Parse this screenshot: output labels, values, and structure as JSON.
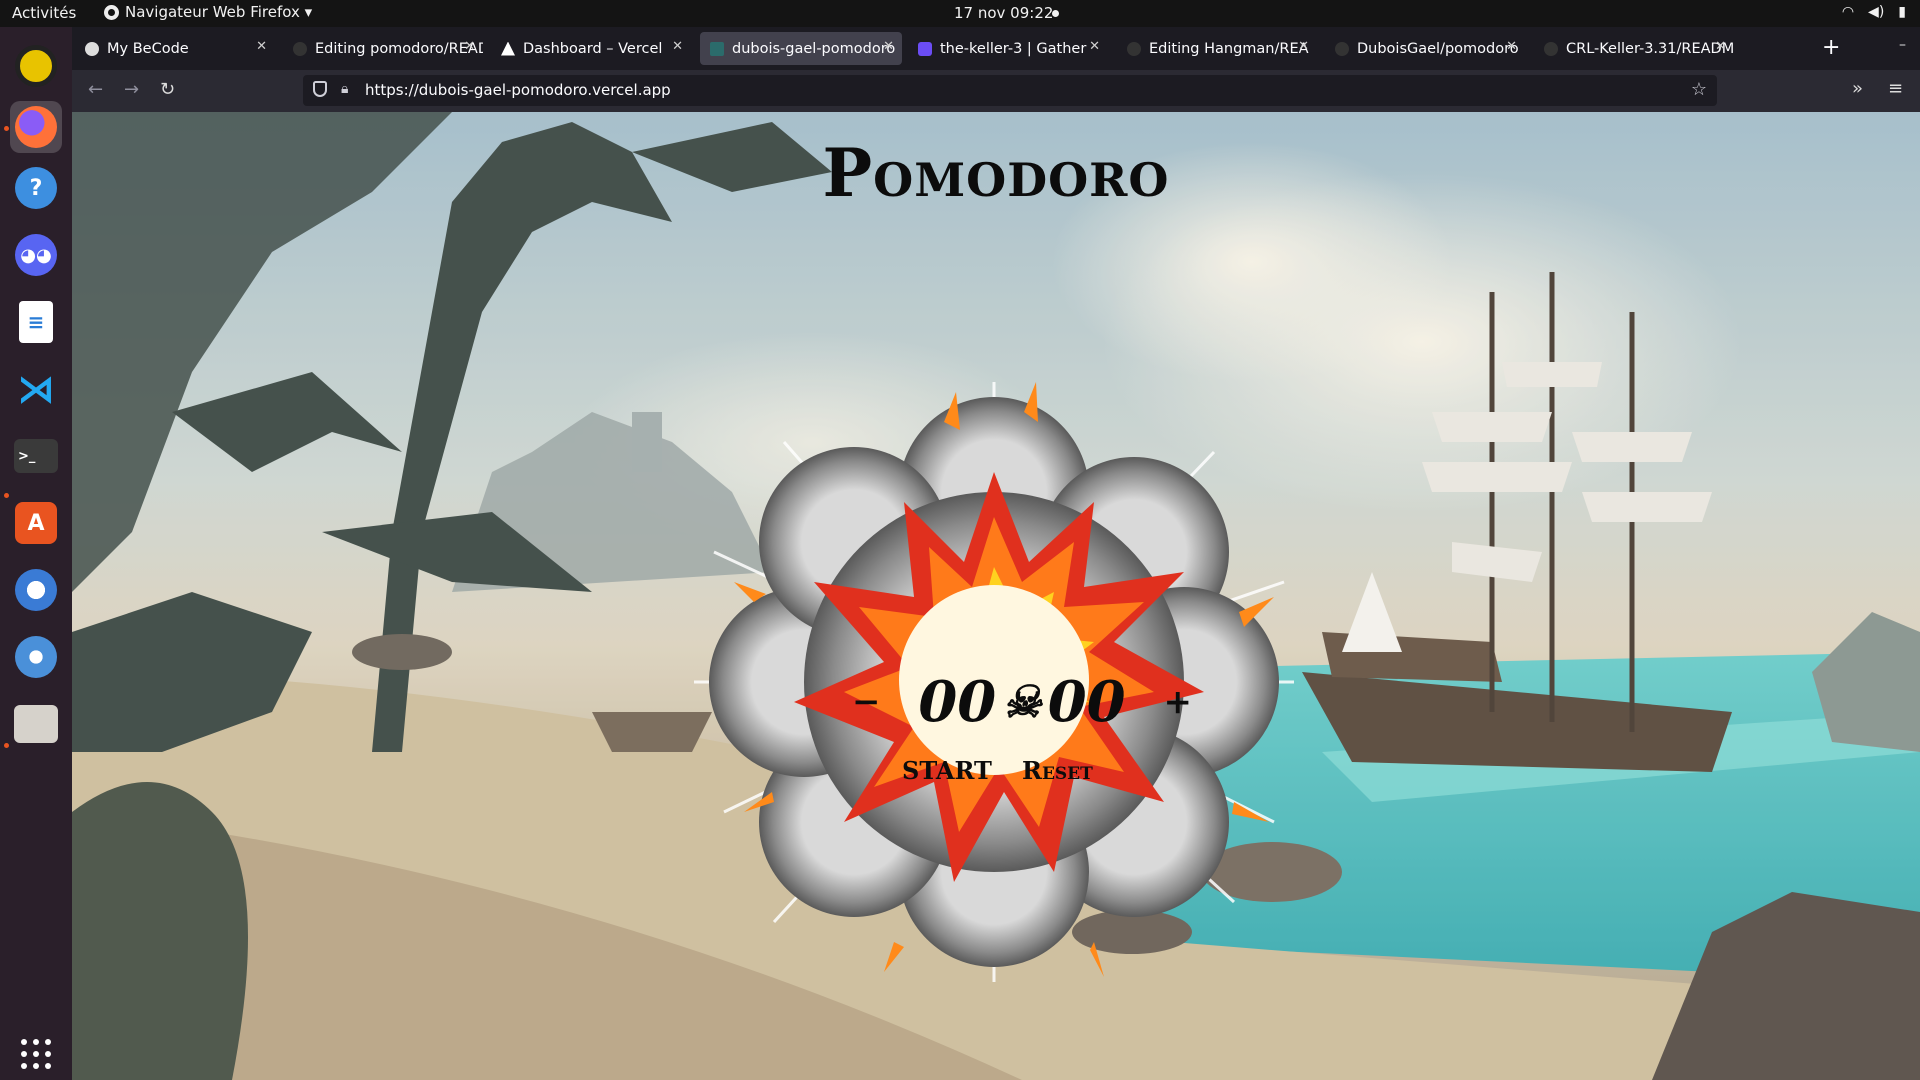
{
  "topbar": {
    "activities": "Activités",
    "app_menu": "Navigateur Web Firefox ▾",
    "clock": "17 nov  09:22"
  },
  "dock": {
    "items": [
      {
        "name": "rhythmbox",
        "color": "#e8c300"
      },
      {
        "name": "firefox",
        "color": "#ff7139"
      },
      {
        "name": "help",
        "color": "#3d8fe0"
      },
      {
        "name": "discord",
        "color": "#5865f2"
      },
      {
        "name": "libreoffice-writer",
        "color": "#2a7cd6"
      },
      {
        "name": "vscode",
        "color": "#23a9f2"
      },
      {
        "name": "terminal",
        "color": "#3a3a3a"
      },
      {
        "name": "ubuntu-software",
        "color": "#e95420"
      },
      {
        "name": "thunderbird",
        "color": "#3a7bd5"
      },
      {
        "name": "chromium",
        "color": "#4a90d9"
      },
      {
        "name": "files",
        "color": "#b8b4ad"
      }
    ],
    "apps_grid_icon": "grid-icon"
  },
  "browser": {
    "tabs": [
      {
        "label": "My BeCode",
        "selected": false
      },
      {
        "label": "Editing pomodoro/READ",
        "selected": false
      },
      {
        "label": "Dashboard – Vercel",
        "selected": false
      },
      {
        "label": "dubois-gael-pomodoro",
        "selected": true
      },
      {
        "label": "the-keller-3 | Gather",
        "selected": false
      },
      {
        "label": "Editing Hangman/REA",
        "selected": false
      },
      {
        "label": "DuboisGael/pomodoro",
        "selected": false
      },
      {
        "label": "CRL-Keller-3.31/READM",
        "selected": false
      }
    ],
    "url": "https://dubois-gael-pomodoro.vercel.app"
  },
  "page": {
    "title": "Pomodoro",
    "timer": {
      "minutes": "00",
      "separator": "☠",
      "seconds": "00"
    },
    "minus_label": "−",
    "plus_label": "+",
    "start_label": "START",
    "reset_label": "Reset"
  }
}
